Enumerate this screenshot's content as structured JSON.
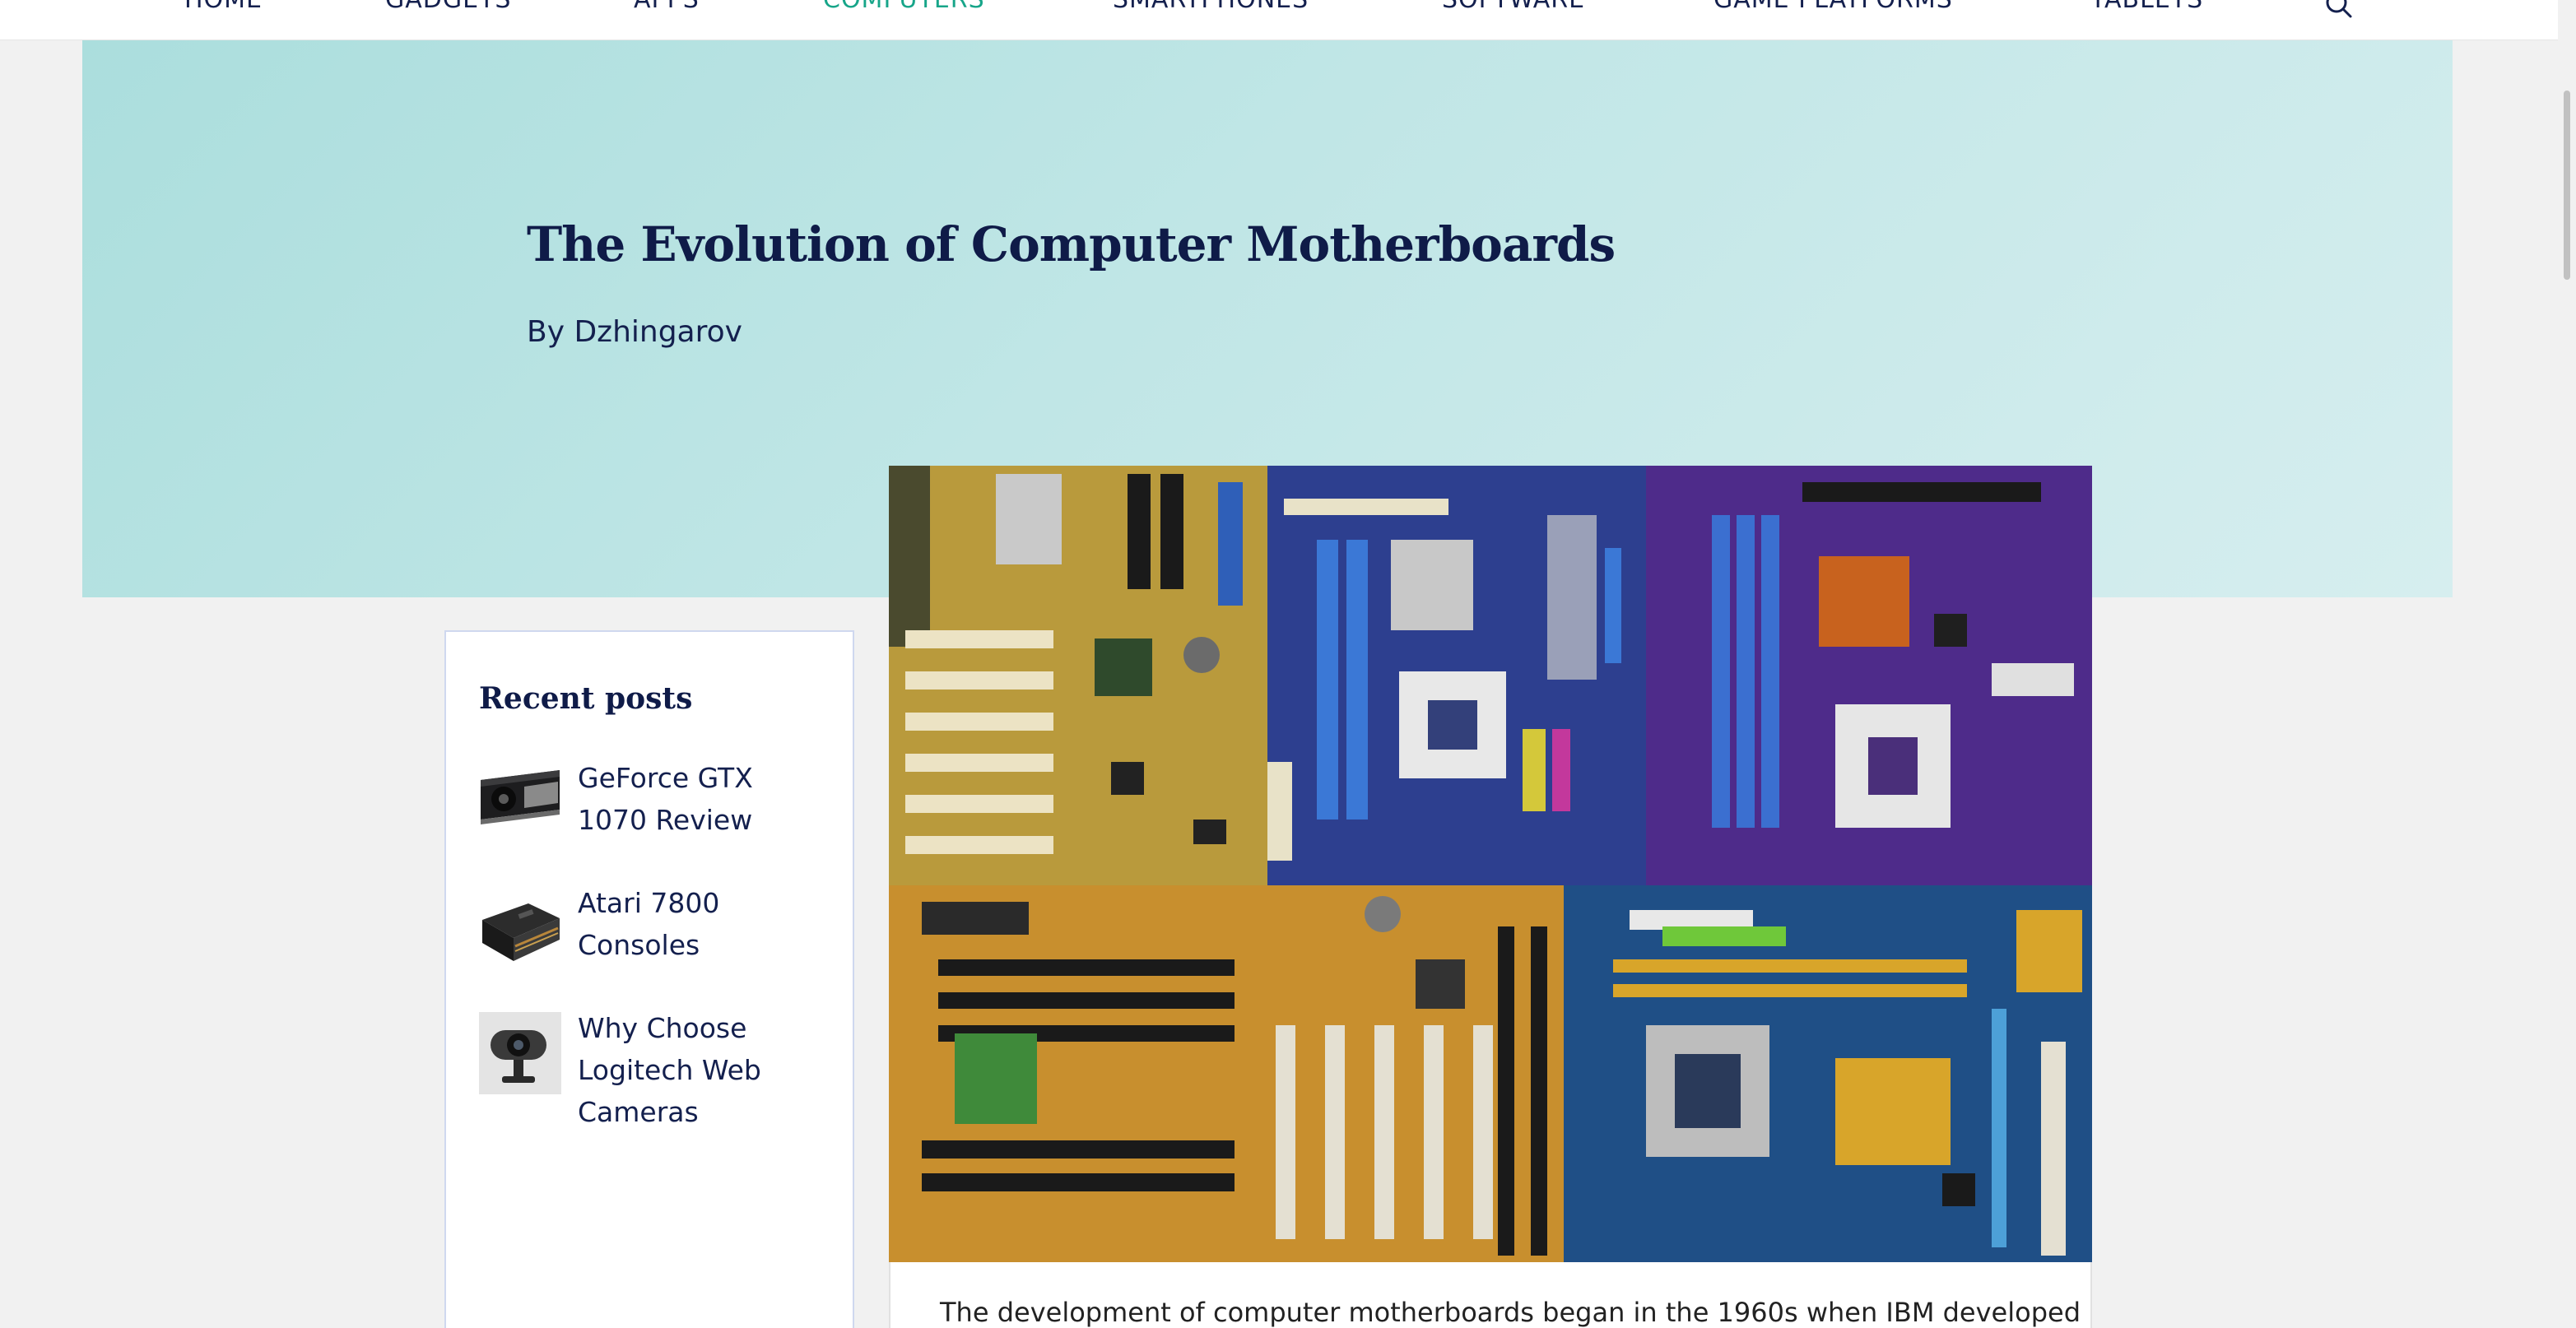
{
  "nav": {
    "items": [
      {
        "label": "HOME"
      },
      {
        "label": "GADGETS"
      },
      {
        "label": "APPS"
      },
      {
        "label": "COMPUTERS",
        "active": true
      },
      {
        "label": "SMARTPHONES"
      },
      {
        "label": "SOFTWARE"
      },
      {
        "label": "GAME PLATFORMS"
      },
      {
        "label": "TABLETS"
      }
    ],
    "search_icon": "search-icon"
  },
  "hero": {
    "title": "The Evolution of Computer Motherboards",
    "byline": "By Dzhingarov"
  },
  "sidebar": {
    "title": "Recent posts",
    "items": [
      {
        "label": "GeForce GTX 1070 Review",
        "thumb": "graphics-card-thumbnail"
      },
      {
        "label": "Atari 7800 Consoles",
        "thumb": "game-console-thumbnail"
      },
      {
        "label": "Why Choose Logitech Web Cameras",
        "thumb": "webcam-thumbnail"
      }
    ]
  },
  "article": {
    "image": "motherboards-collage-image",
    "first_line": "The development of computer motherboards began in the 1960s when IBM developed"
  },
  "colors": {
    "nav_text": "#14204e",
    "nav_active": "#17a589",
    "hero_bg": "#b6e2e1",
    "title_text": "#0f1b48",
    "page_bg": "#f1f1f1"
  }
}
